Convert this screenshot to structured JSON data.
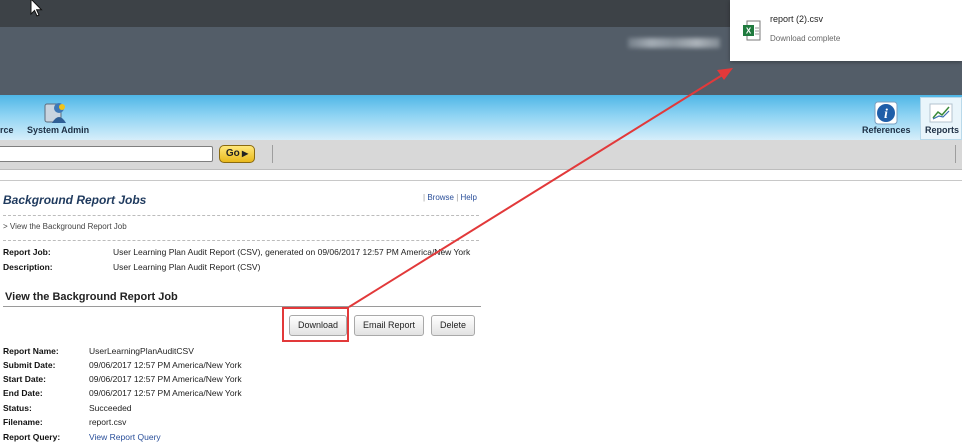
{
  "download_popup": {
    "filename": "report (2).csv",
    "status": "Download complete",
    "file_icon": "excel-file-icon"
  },
  "nav": {
    "left_partial_label": "rce",
    "system_admin_label": "System Admin",
    "references_label": "References",
    "reports_label": "Reports",
    "icons": [
      "system-admin-icon",
      "references-info-icon",
      "reports-chart-icon"
    ]
  },
  "search": {
    "value": "",
    "go_label": "Go"
  },
  "page": {
    "title": "Background Report Jobs",
    "links": {
      "browse": "Browse",
      "help": "Help"
    },
    "breadcrumb": "> View the Background Report Job",
    "job": {
      "report_job_label": "Report Job:",
      "report_job_value": "User Learning Plan Audit Report (CSV), generated on 09/06/2017 12:57 PM America/New York",
      "description_label": "Description:",
      "description_value": "User Learning Plan Audit Report (CSV)"
    },
    "section_title": "View the Background Report Job",
    "buttons": {
      "download": "Download",
      "email": "Email Report",
      "delete": "Delete"
    },
    "details": {
      "report_name_label": "Report Name:",
      "report_name_value": "UserLearningPlanAuditCSV",
      "submit_label": "Submit Date:",
      "submit_value": "09/06/2017 12:57 PM America/New York",
      "start_label": "Start Date:",
      "start_value": "09/06/2017 12:57 PM America/New York",
      "end_label": "End Date:",
      "end_value": "09/06/2017 12:57 PM America/New York",
      "status_label": "Status:",
      "status_value": "Succeeded",
      "filename_label": "Filename:",
      "filename_value": "report.csv",
      "query_label": "Report Query:",
      "query_value": "View Report Query"
    }
  },
  "colors": {
    "annotation_red": "#e2393a",
    "link_blue": "#2a4f9a",
    "nav_blue": "#4fb6e6",
    "go_yellow": "#f2cc3a"
  }
}
